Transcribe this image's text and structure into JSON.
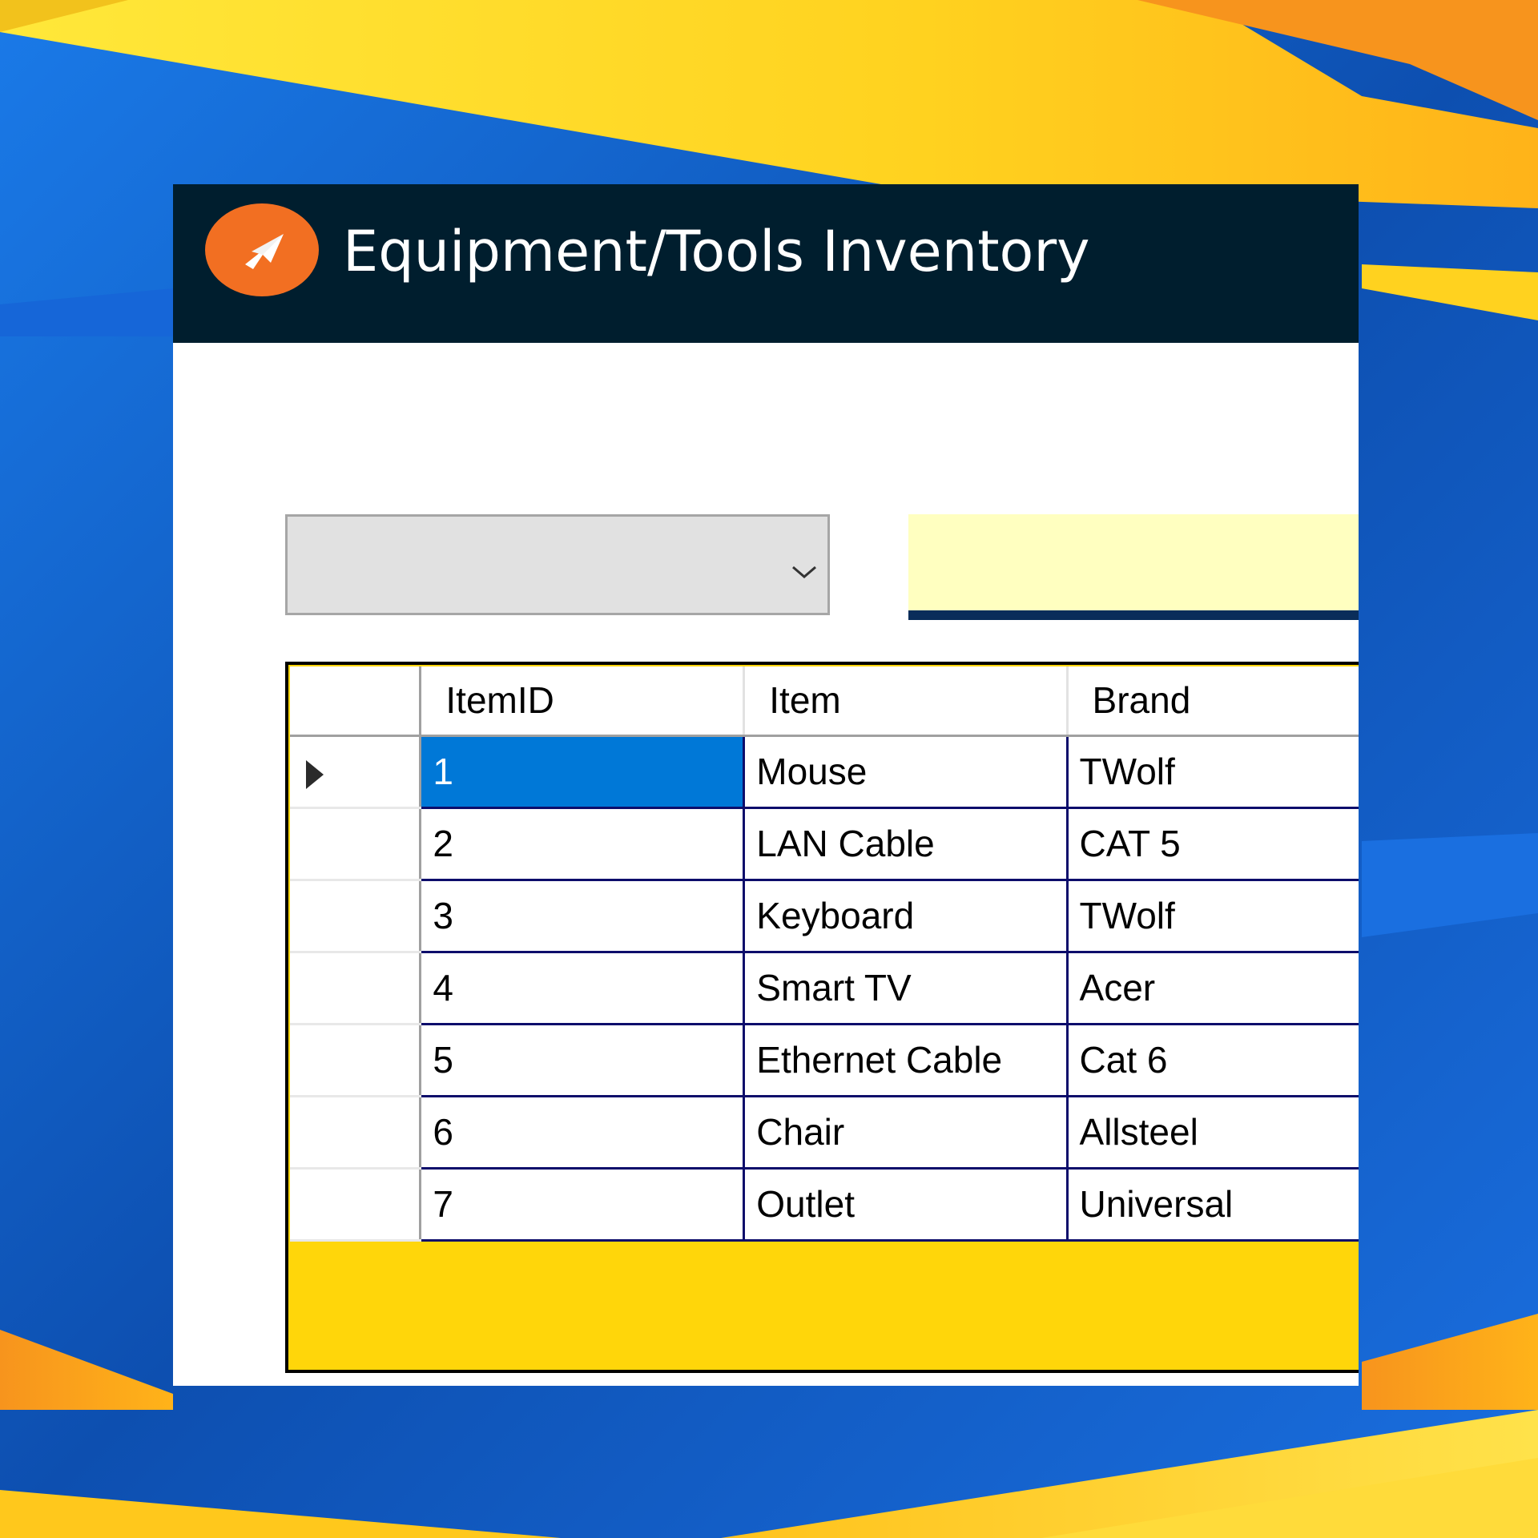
{
  "window": {
    "title": "Equipment/Tools Inventory",
    "logo_icon": "paper-plane-icon",
    "title_bar_color": "#001e2e",
    "logo_color": "#f26f22"
  },
  "filter": {
    "category_selected": "",
    "search_value": "",
    "search_background": "#ffffc0"
  },
  "grid": {
    "columns": [
      "ItemID",
      "Item",
      "Brand"
    ],
    "selected_row": 0,
    "selection_color": "#0078d7",
    "empty_area_color": "#ffd60a",
    "rows": [
      {
        "id": "1",
        "item": "Mouse",
        "brand": "TWolf"
      },
      {
        "id": "2",
        "item": "LAN Cable",
        "brand": "CAT 5"
      },
      {
        "id": "3",
        "item": "Keyboard",
        "brand": "TWolf"
      },
      {
        "id": "4",
        "item": "Smart TV",
        "brand": "Acer"
      },
      {
        "id": "5",
        "item": "Ethernet Cable",
        "brand": "Cat 6"
      },
      {
        "id": "6",
        "item": "Chair",
        "brand": "Allsteel"
      },
      {
        "id": "7",
        "item": "Outlet",
        "brand": "Universal"
      }
    ]
  },
  "colors": {
    "background_blue": "#1565d8",
    "background_yellow": "#ffd21f",
    "background_orange": "#f7941d"
  }
}
